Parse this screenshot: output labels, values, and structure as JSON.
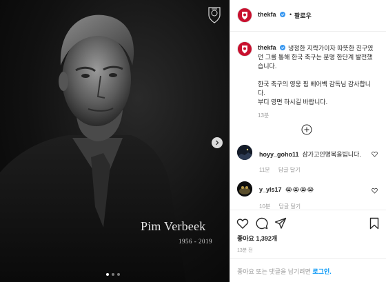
{
  "post": {
    "photo": {
      "caption_name": "Pim Verbeek",
      "caption_years": "1956 - 2019",
      "carousel_dots": 3,
      "active_dot": 1
    },
    "header": {
      "username": "thekfa",
      "separator": "•",
      "follow_label": "팔로우"
    },
    "caption": {
      "username": "thekfa",
      "paragraph1": "냉정한 지략가이자 따뜻한 친구였던 그를 통해 한국 축구는 분명 한단계 발전했습니다.",
      "paragraph2_line1": "한국 축구의 영웅 핌 베어벡 감독님 감사합니다.",
      "paragraph2_line2": "부디 영면 하시길 바랍니다.",
      "time": "13분"
    },
    "comments": [
      {
        "username": "hoyy_goho11",
        "text": "삼가고인명복을빕니다.",
        "time": "11분",
        "reply_label": "답글 달기"
      },
      {
        "username": "y_yls17",
        "text": "😭😭😭😭",
        "time": "10분",
        "reply_label": "답글 달기"
      }
    ],
    "likes_text": "좋아요 1,392개",
    "posted_ago": "13분 전",
    "login_prompt": "좋아요 또는 댓글을 남기려면",
    "login_link": "로그인."
  },
  "colors": {
    "brand_red": "#c8102e",
    "link_blue": "#0095f6",
    "muted_text": "#999999"
  },
  "icons": [
    "kfa-crest-icon",
    "verified-badge-icon",
    "next-arrow-icon",
    "load-more-icon",
    "heart-icon",
    "comment-icon",
    "share-icon",
    "bookmark-icon"
  ]
}
